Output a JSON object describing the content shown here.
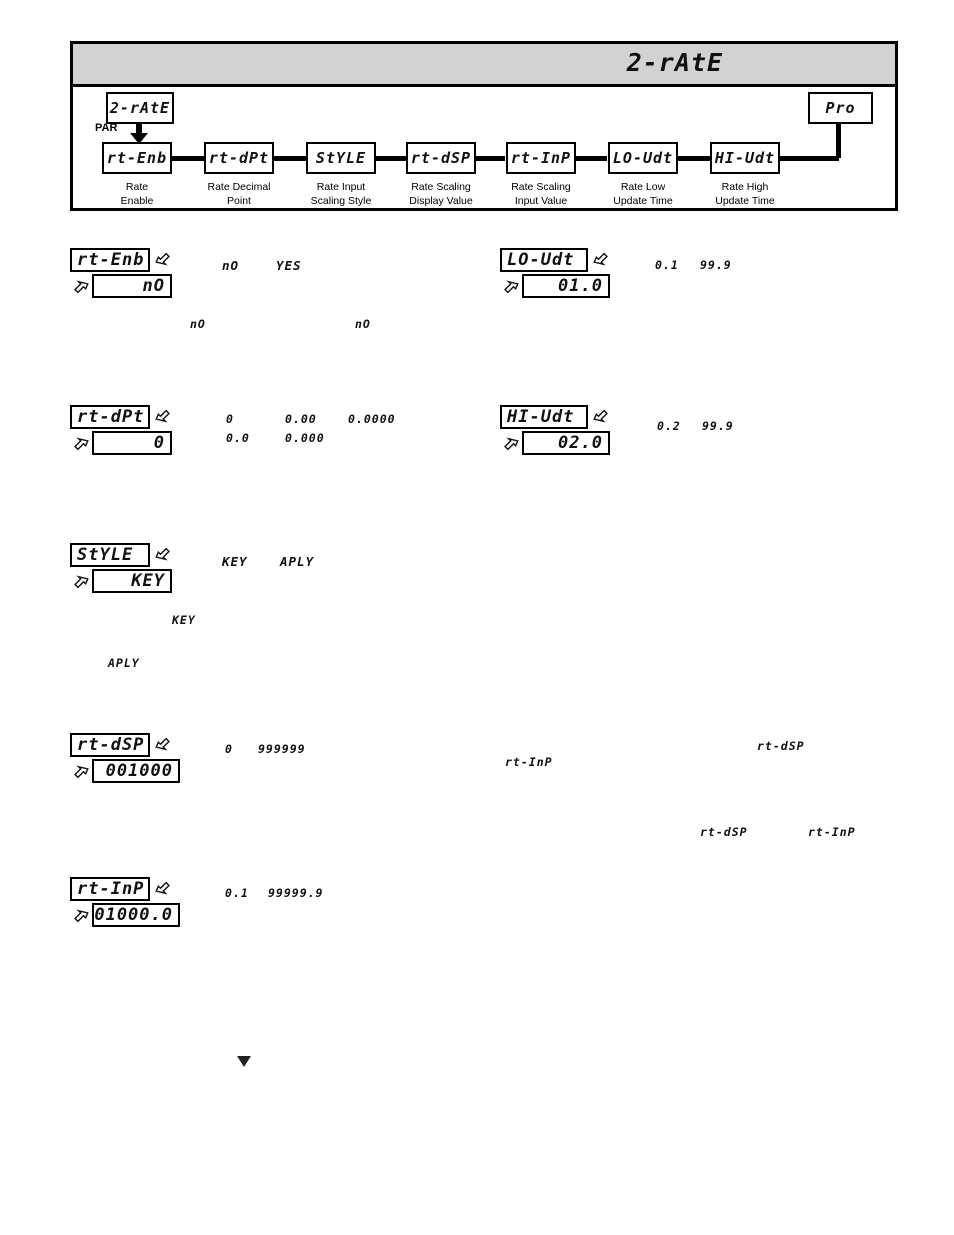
{
  "flowchart": {
    "header_title": "2-rAtE",
    "entry_box": "2-rAtE",
    "par_label": "PAR",
    "exit_box": "Pro",
    "steps": [
      {
        "code": "rt-Enb",
        "caption": "Rate\nEnable"
      },
      {
        "code": "rt-dPt",
        "caption": "Rate Decimal\nPoint"
      },
      {
        "code": "StYLE",
        "caption": "Rate Input\nScaling Style"
      },
      {
        "code": "rt-dSP",
        "caption": "Rate Scaling\nDisplay Value"
      },
      {
        "code": "rt-InP",
        "caption": "Rate Scaling\nInput Value"
      },
      {
        "code": "LO-Udt",
        "caption": "Rate Low\nUpdate Time"
      },
      {
        "code": "HI-Udt",
        "caption": "Rate High\nUpdate Time"
      }
    ]
  },
  "parameters": [
    {
      "id": "rt-enb",
      "name": "rt-Enb",
      "value": "nO",
      "options": [
        "nO",
        "YES"
      ],
      "body_refs": [
        "nO",
        "nO"
      ]
    },
    {
      "id": "rt-dpt",
      "name": "rt-dPt",
      "value": "0",
      "options_row1": [
        "0",
        "0.00",
        "0.0000"
      ],
      "options_row2": [
        "0.0",
        "0.000"
      ]
    },
    {
      "id": "style",
      "name": "StYLE",
      "value": "KEY",
      "options": [
        "KEY",
        "APLY"
      ],
      "body_refs": [
        "KEY",
        "APLY"
      ]
    },
    {
      "id": "rt-dsp",
      "name": "rt-dSP",
      "value": "001000",
      "range_min": "0",
      "range_max": "999999"
    },
    {
      "id": "rt-inp",
      "name": "rt-InP",
      "value": "01000.0",
      "range_min": "0.1",
      "range_max": "99999.9"
    },
    {
      "id": "lo-udt",
      "name": "LO-Udt",
      "value": "01.0",
      "range_min": "0.1",
      "range_max": "99.9"
    },
    {
      "id": "hi-udt",
      "name": "HI-Udt",
      "value": "02.0",
      "range_min": "0.2",
      "range_max": "99.9"
    }
  ],
  "inline_refs": {
    "rt_inp_a": "rt-InP",
    "rt_dsp_a": "rt-dSP",
    "rt_dsp_b": "rt-dSP",
    "rt_inp_b": "rt-InP"
  }
}
